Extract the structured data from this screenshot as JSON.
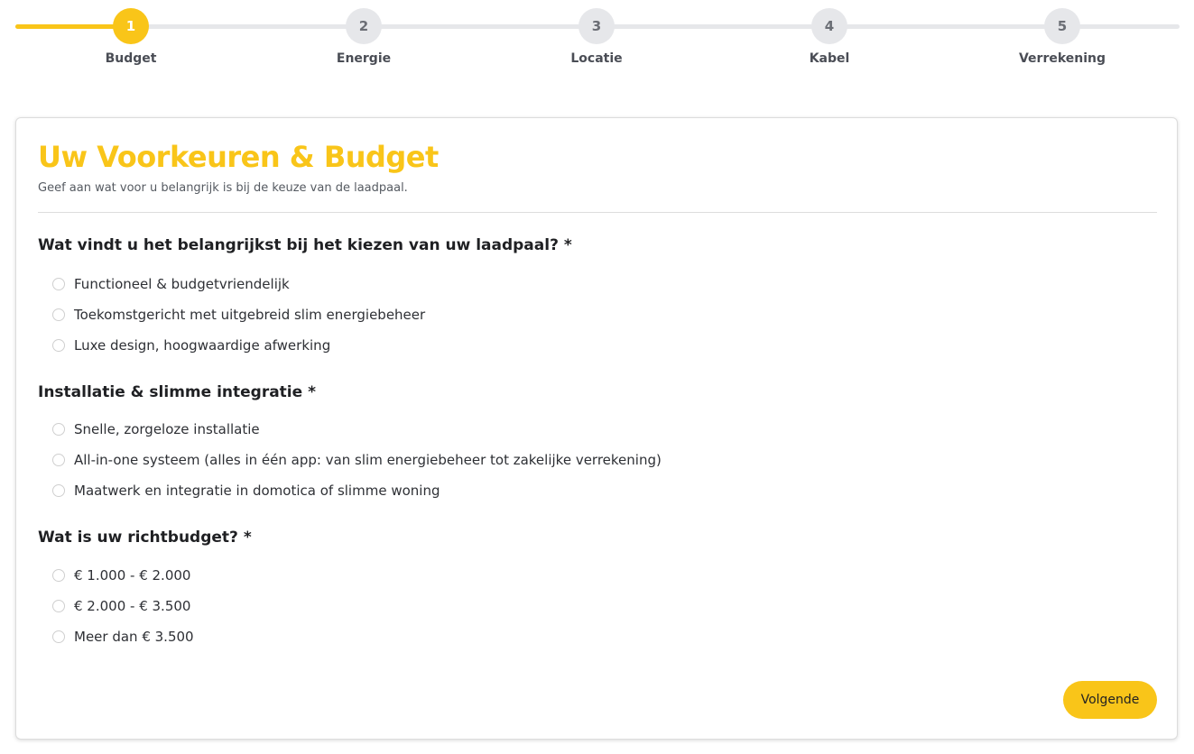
{
  "stepper": {
    "active_step": 1,
    "steps": [
      {
        "number": "1",
        "label": "Budget"
      },
      {
        "number": "2",
        "label": "Energie"
      },
      {
        "number": "3",
        "label": "Locatie"
      },
      {
        "number": "4",
        "label": "Kabel"
      },
      {
        "number": "5",
        "label": "Verrekening"
      }
    ]
  },
  "form": {
    "title": "Uw Voorkeuren & Budget",
    "subtitle": "Geef aan wat voor u belangrijk is bij de keuze van de laadpaal.",
    "questions": [
      {
        "label": "Wat vindt u het belangrijkst bij het kiezen van uw laadpaal? *",
        "options": [
          "Functioneel & budgetvriendelijk",
          "Toekomstgericht met uitgebreid slim energiebeheer",
          "Luxe design, hoogwaardige afwerking"
        ]
      },
      {
        "label": "Installatie & slimme integratie *",
        "options": [
          "Snelle, zorgeloze installatie",
          "All-in-one systeem (alles in één app: van slim energiebeheer tot zakelijke verrekening)",
          "Maatwerk en integratie in domotica of slimme woning"
        ]
      },
      {
        "label": "Wat is uw richtbudget? *",
        "options": [
          "€ 1.000 - € 2.000",
          "€ 2.000 - € 3.500",
          "Meer dan € 3.500"
        ]
      }
    ],
    "next_label": "Volgende"
  },
  "colors": {
    "accent": "#f9c519",
    "inactive_step": "#e6e7ea"
  }
}
